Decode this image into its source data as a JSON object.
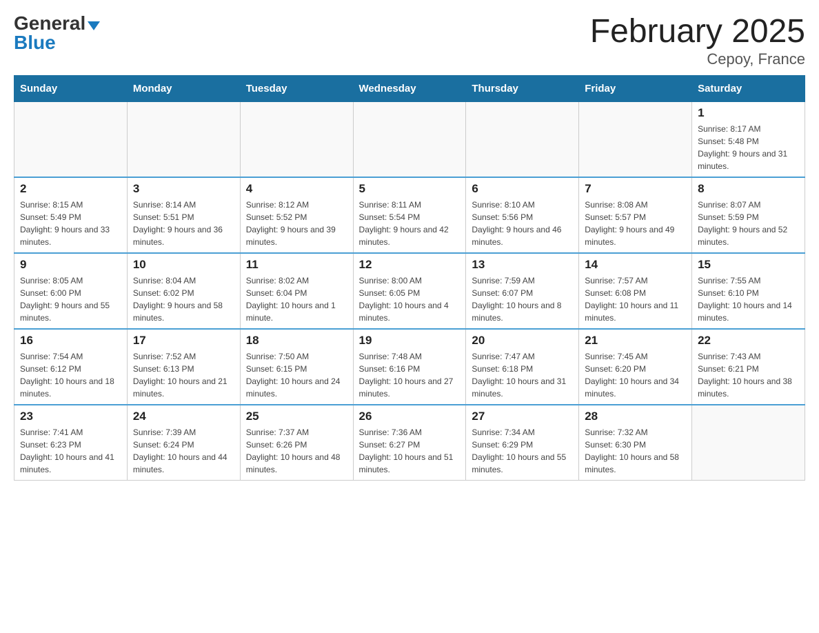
{
  "logo": {
    "general": "General",
    "blue": "Blue",
    "arrow_char": "▼"
  },
  "title": "February 2025",
  "subtitle": "Cepoy, France",
  "days_of_week": [
    "Sunday",
    "Monday",
    "Tuesday",
    "Wednesday",
    "Thursday",
    "Friday",
    "Saturday"
  ],
  "weeks": [
    [
      {
        "day": "",
        "info": ""
      },
      {
        "day": "",
        "info": ""
      },
      {
        "day": "",
        "info": ""
      },
      {
        "day": "",
        "info": ""
      },
      {
        "day": "",
        "info": ""
      },
      {
        "day": "",
        "info": ""
      },
      {
        "day": "1",
        "info": "Sunrise: 8:17 AM\nSunset: 5:48 PM\nDaylight: 9 hours and 31 minutes."
      }
    ],
    [
      {
        "day": "2",
        "info": "Sunrise: 8:15 AM\nSunset: 5:49 PM\nDaylight: 9 hours and 33 minutes."
      },
      {
        "day": "3",
        "info": "Sunrise: 8:14 AM\nSunset: 5:51 PM\nDaylight: 9 hours and 36 minutes."
      },
      {
        "day": "4",
        "info": "Sunrise: 8:12 AM\nSunset: 5:52 PM\nDaylight: 9 hours and 39 minutes."
      },
      {
        "day": "5",
        "info": "Sunrise: 8:11 AM\nSunset: 5:54 PM\nDaylight: 9 hours and 42 minutes."
      },
      {
        "day": "6",
        "info": "Sunrise: 8:10 AM\nSunset: 5:56 PM\nDaylight: 9 hours and 46 minutes."
      },
      {
        "day": "7",
        "info": "Sunrise: 8:08 AM\nSunset: 5:57 PM\nDaylight: 9 hours and 49 minutes."
      },
      {
        "day": "8",
        "info": "Sunrise: 8:07 AM\nSunset: 5:59 PM\nDaylight: 9 hours and 52 minutes."
      }
    ],
    [
      {
        "day": "9",
        "info": "Sunrise: 8:05 AM\nSunset: 6:00 PM\nDaylight: 9 hours and 55 minutes."
      },
      {
        "day": "10",
        "info": "Sunrise: 8:04 AM\nSunset: 6:02 PM\nDaylight: 9 hours and 58 minutes."
      },
      {
        "day": "11",
        "info": "Sunrise: 8:02 AM\nSunset: 6:04 PM\nDaylight: 10 hours and 1 minute."
      },
      {
        "day": "12",
        "info": "Sunrise: 8:00 AM\nSunset: 6:05 PM\nDaylight: 10 hours and 4 minutes."
      },
      {
        "day": "13",
        "info": "Sunrise: 7:59 AM\nSunset: 6:07 PM\nDaylight: 10 hours and 8 minutes."
      },
      {
        "day": "14",
        "info": "Sunrise: 7:57 AM\nSunset: 6:08 PM\nDaylight: 10 hours and 11 minutes."
      },
      {
        "day": "15",
        "info": "Sunrise: 7:55 AM\nSunset: 6:10 PM\nDaylight: 10 hours and 14 minutes."
      }
    ],
    [
      {
        "day": "16",
        "info": "Sunrise: 7:54 AM\nSunset: 6:12 PM\nDaylight: 10 hours and 18 minutes."
      },
      {
        "day": "17",
        "info": "Sunrise: 7:52 AM\nSunset: 6:13 PM\nDaylight: 10 hours and 21 minutes."
      },
      {
        "day": "18",
        "info": "Sunrise: 7:50 AM\nSunset: 6:15 PM\nDaylight: 10 hours and 24 minutes."
      },
      {
        "day": "19",
        "info": "Sunrise: 7:48 AM\nSunset: 6:16 PM\nDaylight: 10 hours and 27 minutes."
      },
      {
        "day": "20",
        "info": "Sunrise: 7:47 AM\nSunset: 6:18 PM\nDaylight: 10 hours and 31 minutes."
      },
      {
        "day": "21",
        "info": "Sunrise: 7:45 AM\nSunset: 6:20 PM\nDaylight: 10 hours and 34 minutes."
      },
      {
        "day": "22",
        "info": "Sunrise: 7:43 AM\nSunset: 6:21 PM\nDaylight: 10 hours and 38 minutes."
      }
    ],
    [
      {
        "day": "23",
        "info": "Sunrise: 7:41 AM\nSunset: 6:23 PM\nDaylight: 10 hours and 41 minutes."
      },
      {
        "day": "24",
        "info": "Sunrise: 7:39 AM\nSunset: 6:24 PM\nDaylight: 10 hours and 44 minutes."
      },
      {
        "day": "25",
        "info": "Sunrise: 7:37 AM\nSunset: 6:26 PM\nDaylight: 10 hours and 48 minutes."
      },
      {
        "day": "26",
        "info": "Sunrise: 7:36 AM\nSunset: 6:27 PM\nDaylight: 10 hours and 51 minutes."
      },
      {
        "day": "27",
        "info": "Sunrise: 7:34 AM\nSunset: 6:29 PM\nDaylight: 10 hours and 55 minutes."
      },
      {
        "day": "28",
        "info": "Sunrise: 7:32 AM\nSunset: 6:30 PM\nDaylight: 10 hours and 58 minutes."
      },
      {
        "day": "",
        "info": ""
      }
    ]
  ]
}
